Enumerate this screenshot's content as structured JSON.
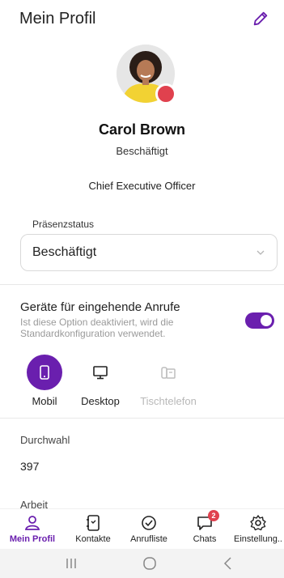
{
  "header": {
    "title": "Mein Profil",
    "edit_icon": "pencil-icon"
  },
  "profile": {
    "name": "Carol Brown",
    "status": "Beschäftigt",
    "status_color": "#e0414e",
    "job_title": "Chief Executive Officer"
  },
  "presence": {
    "label": "Präsenzstatus",
    "value": "Beschäftigt"
  },
  "devices": {
    "title": "Geräte für eingehende Anrufe",
    "subtitle": "Ist diese Option deaktiviert, wird die Standardkonfiguration verwendet.",
    "toggle_on": true,
    "accent": "#6a1fae",
    "items": [
      {
        "label": "Mobil",
        "icon": "mobile-phone-icon",
        "selected": true
      },
      {
        "label": "Desktop",
        "icon": "monitor-icon",
        "selected": false
      },
      {
        "label": "Tischtelefon",
        "icon": "desk-phone-icon",
        "selected": false,
        "disabled": true
      }
    ]
  },
  "fields": [
    {
      "label": "Durchwahl",
      "value": "397"
    },
    {
      "label": "Arbeit",
      "value": ""
    }
  ],
  "tabs": [
    {
      "label": "Mein Profil",
      "icon": "user-icon",
      "active": true
    },
    {
      "label": "Kontakte",
      "icon": "contacts-book-icon"
    },
    {
      "label": "Anrufliste",
      "icon": "call-history-icon"
    },
    {
      "label": "Chats",
      "icon": "chat-icon",
      "badge": "2"
    },
    {
      "label": "Einstellung..",
      "icon": "gear-icon"
    }
  ],
  "system_nav": [
    "recent-apps-icon",
    "home-icon",
    "back-icon"
  ]
}
